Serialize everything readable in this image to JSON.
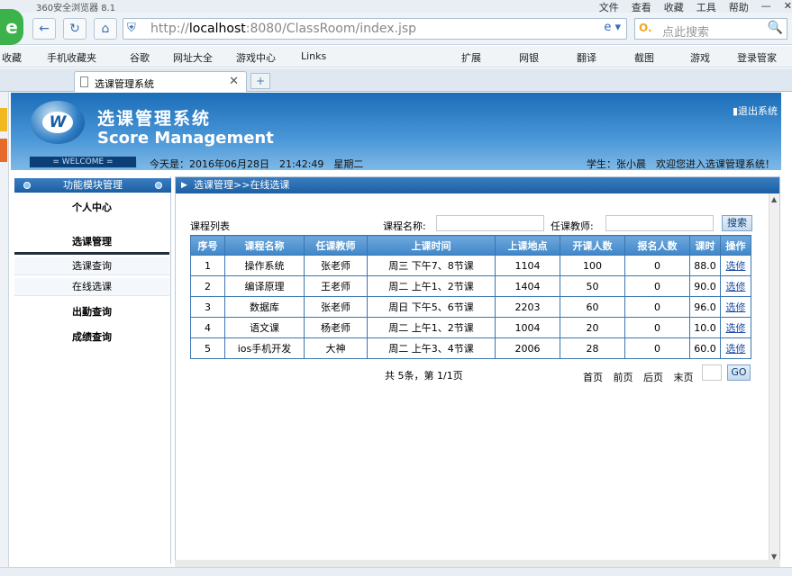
{
  "browser": {
    "app_title": "360安全浏览器 8.1",
    "menu": [
      "文件",
      "查看",
      "收藏",
      "工具",
      "帮助"
    ],
    "url_host": "localhost",
    "url_rest": ":8080/ClassRoom/index.jsp",
    "url_prefix": "http://",
    "search_placeholder": "点此搜索",
    "favorites": [
      "收藏",
      "手机收藏夹",
      "谷歌",
      "网址大全",
      "游戏中心",
      "Links",
      "扩展",
      "网银",
      "翻译",
      "截图",
      "游戏",
      "登录管家"
    ],
    "tab_title": "选课管理系统"
  },
  "header": {
    "title_cn": "选课管理系统",
    "title_en": "Score Management",
    "logout": "退出系统",
    "welcome": "= WELCOME =",
    "date_text": "今天是：2016年06月28日　21:42:49　星期二",
    "user_text": "学生：张小晨　欢迎您进入选课管理系统！"
  },
  "sidebar": {
    "head": "功能模块管理",
    "personal": "个人中心",
    "course_select": "选课管理",
    "sub1": "选课查询",
    "sub2": "在线选课",
    "attendance": "出勤查询",
    "grades": "成绩查询"
  },
  "main": {
    "breadcrumb": "选课管理>>在线选课",
    "list_label": "课程列表",
    "course_name_label": "课程名称:",
    "teacher_label": "任课教师:",
    "search_btn": "搜索",
    "columns": [
      "序号",
      "课程名称",
      "任课教师",
      "上课时间",
      "上课地点",
      "开课人数",
      "报名人数",
      "课时",
      "操作"
    ],
    "rows": [
      [
        "1",
        "操作系统",
        "张老师",
        "周三 下午7、8节课",
        "1104",
        "100",
        "0",
        "88.0",
        "选修"
      ],
      [
        "2",
        "编译原理",
        "王老师",
        "周二 上午1、2节课",
        "1404",
        "50",
        "0",
        "90.0",
        "选修"
      ],
      [
        "3",
        "数据库",
        "张老师",
        "周日 下午5、6节课",
        "2203",
        "60",
        "0",
        "96.0",
        "选修"
      ],
      [
        "4",
        "语文课",
        "杨老师",
        "周二 上午1、2节课",
        "1004",
        "20",
        "0",
        "10.0",
        "选修"
      ],
      [
        "5",
        "ios手机开发",
        "大神",
        "周二 上午3、4节课",
        "2006",
        "28",
        "0",
        "60.0",
        "选修"
      ]
    ],
    "page_info": "共 5条，第 1/1页",
    "first": "首页",
    "prev": "前页",
    "next": "后页",
    "last": "末页",
    "go": "GO"
  }
}
